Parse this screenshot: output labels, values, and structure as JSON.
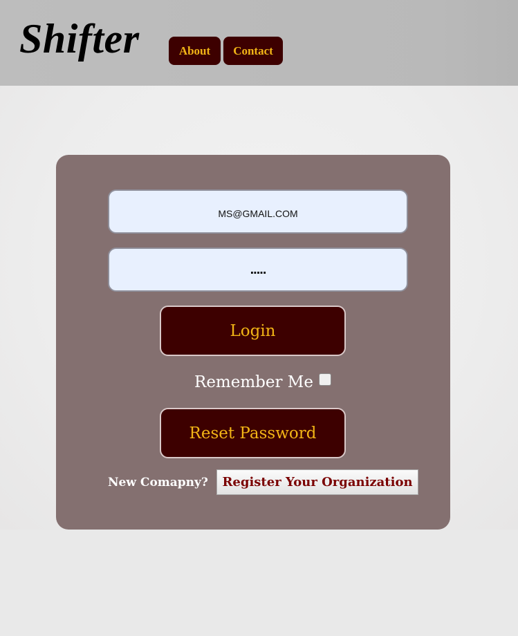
{
  "header": {
    "logo": "Shifter",
    "nav": {
      "about_label": "About",
      "contact_label": "Contact"
    }
  },
  "login_form": {
    "email_value": "MS@GMAIL.COM",
    "password_value": ".....",
    "login_label": "Login",
    "remember_label": "Remember Me",
    "remember_checked": false,
    "reset_label": "Reset Password",
    "new_company_label": "New Comapny?",
    "register_label": "Register Your Organization"
  },
  "colors": {
    "button_bg": "#3d0000",
    "button_text": "#f2b516",
    "card_bg": "#847070",
    "input_bg": "#e8f0fe",
    "register_text": "#7a0000"
  }
}
